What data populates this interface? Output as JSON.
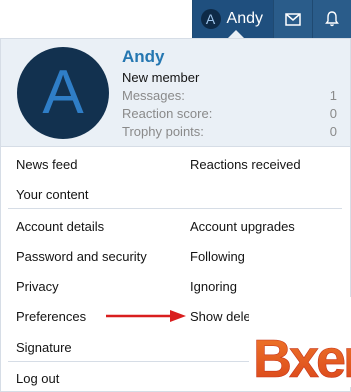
{
  "header": {
    "avatar_letter": "A",
    "username": "Andy",
    "icons": [
      "envelope-icon",
      "bell-icon"
    ],
    "colors": {
      "nav_bg": "#2a5c8a",
      "active_tab": "#1f4f7e"
    }
  },
  "profile": {
    "avatar_letter": "A",
    "name": "Andy",
    "title": "New member",
    "stats": [
      {
        "label": "Messages:",
        "value": "1"
      },
      {
        "label": "Reaction score:",
        "value": "0"
      },
      {
        "label": "Trophy points:",
        "value": "0"
      }
    ],
    "colors": {
      "name": "#2577b1",
      "avatar_bg": "#12314f",
      "avatar_letter": "#2f7ec7",
      "panel_bg": "#eaf0f6"
    }
  },
  "menu": {
    "news_feed": "News feed",
    "reactions_received": "Reactions received",
    "your_content": "Your content",
    "account_details": "Account details",
    "account_upgrades": "Account upgrades",
    "password_security": "Password and security",
    "following": "Following",
    "privacy": "Privacy",
    "ignoring": "Ignoring",
    "preferences": "Preferences",
    "show_deleted": "Show dele",
    "signature": "Signature",
    "log_out": "Log out"
  },
  "annotation": {
    "arrow_color": "#d91e1e"
  },
  "watermark": {
    "text": "Bxen",
    "color": "#e35b1b"
  }
}
